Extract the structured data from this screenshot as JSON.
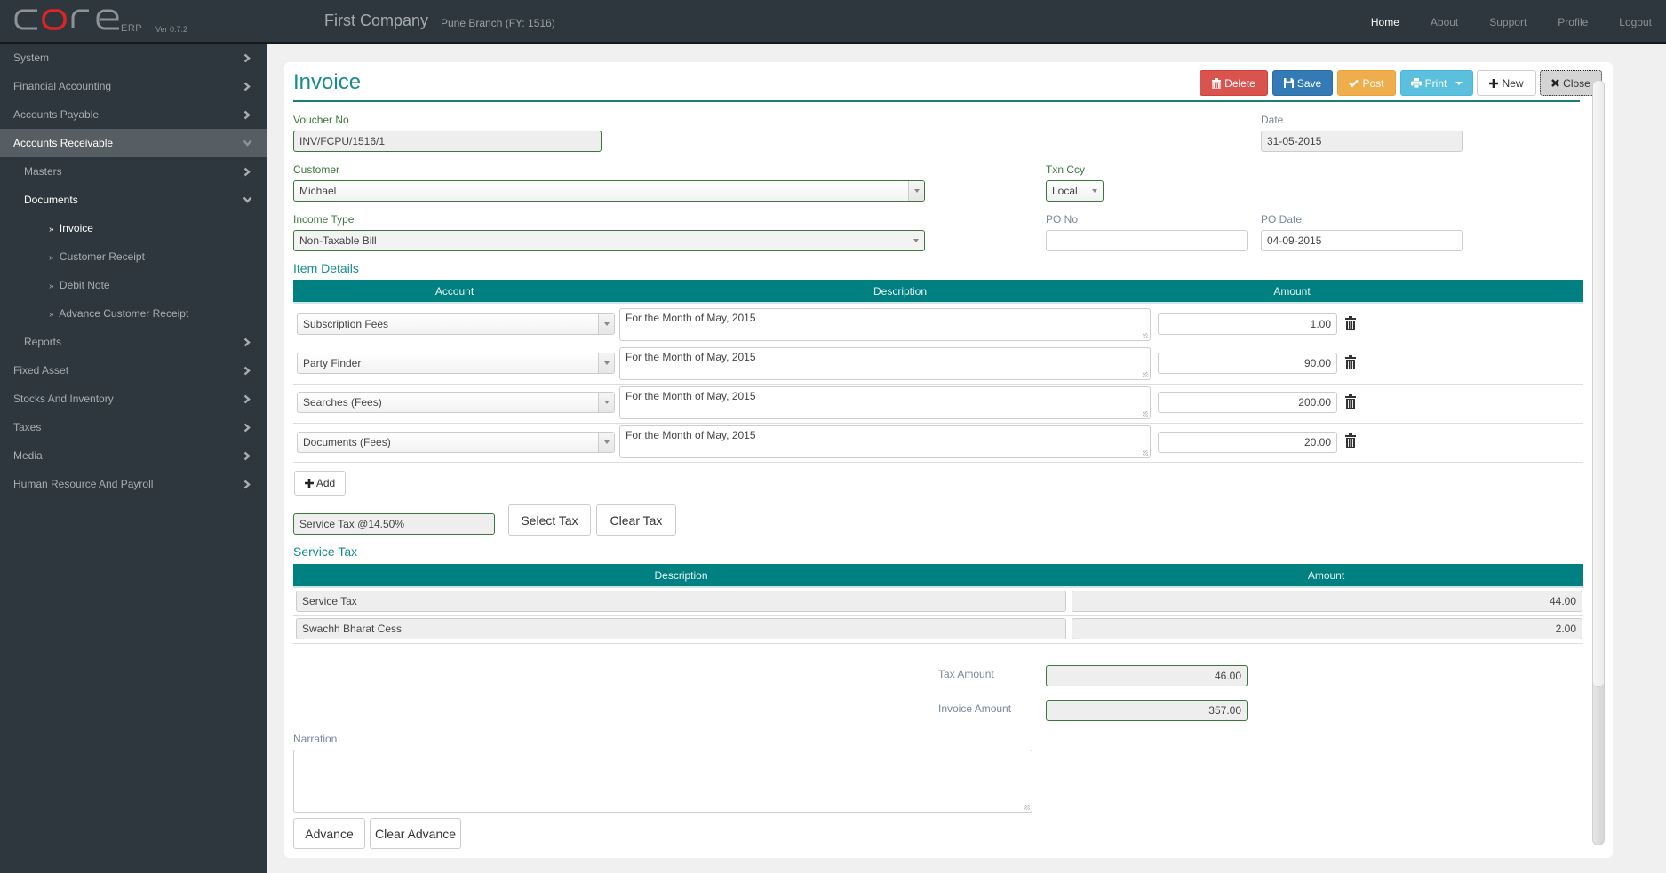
{
  "app": {
    "logo_text": "core",
    "logo_suffix": "ERP",
    "version": "Ver 0.7.2",
    "company": "First Company",
    "branch": "Pune Branch (FY: 1516)",
    "brand_color": "#008080",
    "accent_red": "#e02424"
  },
  "topnav": {
    "items": [
      {
        "label": "Home",
        "active": true
      },
      {
        "label": "About"
      },
      {
        "label": "Support"
      },
      {
        "label": "Profile"
      },
      {
        "label": "Logout"
      }
    ]
  },
  "sidebar": {
    "items": [
      {
        "label": "System",
        "icon": "chevron-right-icon"
      },
      {
        "label": "Financial Accounting",
        "icon": "chevron-right-icon"
      },
      {
        "label": "Accounts Payable",
        "icon": "chevron-right-icon"
      },
      {
        "label": "Accounts Receivable",
        "icon": "chevron-down-icon",
        "open": true
      },
      {
        "label": "Masters",
        "icon": "chevron-right-icon",
        "level": 2
      },
      {
        "label": "Documents",
        "icon": "chevron-down-icon",
        "level": 2,
        "open": true
      },
      {
        "label": "Invoice",
        "prefix": "»",
        "level": 3,
        "active": true
      },
      {
        "label": "Customer Receipt",
        "prefix": "»",
        "level": 3
      },
      {
        "label": "Debit Note",
        "prefix": "»",
        "level": 3
      },
      {
        "label": "Advance Customer Receipt",
        "prefix": "»",
        "level": 3
      },
      {
        "label": "Reports",
        "icon": "chevron-right-icon",
        "level": 2
      },
      {
        "label": "Fixed Asset",
        "icon": "chevron-right-icon"
      },
      {
        "label": "Stocks And Inventory",
        "icon": "chevron-right-icon"
      },
      {
        "label": "Taxes",
        "icon": "chevron-right-icon"
      },
      {
        "label": "Media",
        "icon": "chevron-right-icon"
      },
      {
        "label": "Human Resource And Payroll",
        "icon": "chevron-right-icon"
      }
    ]
  },
  "page": {
    "title": "Invoice",
    "toolbar": {
      "delete": "Delete",
      "save": "Save",
      "post": "Post",
      "print": "Print",
      "new": "New",
      "close": "Close"
    }
  },
  "form": {
    "voucher_no": {
      "label": "Voucher No",
      "value": "INV/FCPU/1516/1"
    },
    "date": {
      "label": "Date",
      "value": "31-05-2015"
    },
    "customer": {
      "label": "Customer",
      "value": "Michael"
    },
    "txn_ccy": {
      "label": "Txn Ccy",
      "value": "Local"
    },
    "income_type": {
      "label": "Income Type",
      "value": "Non-Taxable Bill"
    },
    "po_no": {
      "label": "PO No",
      "value": ""
    },
    "po_date": {
      "label": "PO Date",
      "value": "04-09-2015"
    }
  },
  "items": {
    "title": "Item Details",
    "columns": [
      "Account",
      "Description",
      "Amount"
    ],
    "rows": [
      {
        "account": "Subscription Fees",
        "description": "For the Month of May, 2015",
        "amount": "1.00"
      },
      {
        "account": "Party Finder",
        "description": "For the Month of May, 2015",
        "amount": "90.00"
      },
      {
        "account": "Searches (Fees)",
        "description": "For the Month of May, 2015",
        "amount": "200.00"
      },
      {
        "account": "Documents (Fees)",
        "description": "For the Month of May, 2015",
        "amount": "20.00"
      }
    ],
    "add_label": "Add"
  },
  "tax": {
    "selected": "Service Tax @14.50%",
    "select_label": "Select Tax",
    "clear_label": "Clear Tax",
    "title": "Service Tax",
    "columns": [
      "Description",
      "Amount"
    ],
    "rows": [
      {
        "description": "Service Tax",
        "amount": "44.00"
      },
      {
        "description": "Swachh Bharat Cess",
        "amount": "2.00"
      }
    ]
  },
  "totals": {
    "tax_amount": {
      "label": "Tax Amount",
      "value": "46.00"
    },
    "invoice_amount": {
      "label": "Invoice Amount",
      "value": "357.00"
    }
  },
  "narration": {
    "label": "Narration",
    "value": ""
  },
  "advance": {
    "advance_label": "Advance",
    "clear_label": "Clear Advance"
  }
}
